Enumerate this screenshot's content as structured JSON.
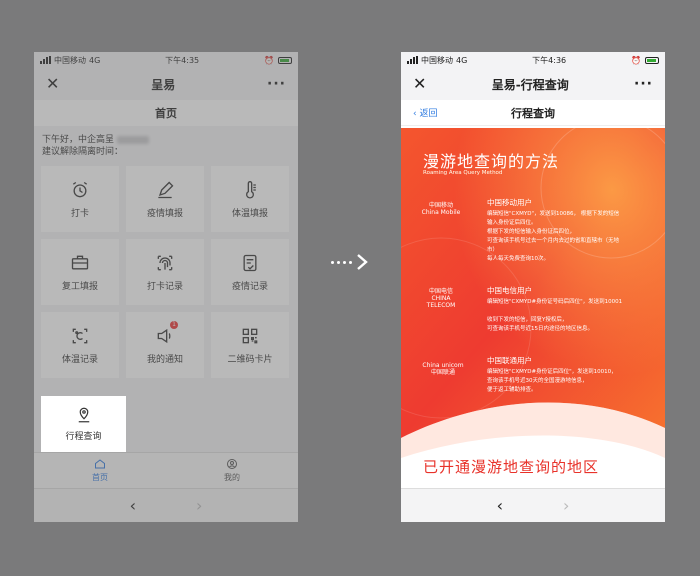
{
  "left_phone": {
    "status": {
      "carrier": "中国移动",
      "network": "4G",
      "time": "下午4:35"
    },
    "window_title": "呈易",
    "page_header": "首页",
    "greeting_line1": "下午好，中企高呈",
    "greeting_line2": "建议解除隔离时间：",
    "tiles": [
      "打卡",
      "疫情填报",
      "体温填报",
      "复工填报",
      "打卡记录",
      "疫情记录",
      "体温记录",
      "我的通知",
      "二维码卡片",
      "行程查询"
    ],
    "badge": "1",
    "tabs": [
      "首页",
      "我的"
    ]
  },
  "right_phone": {
    "status": {
      "carrier": "中国移动",
      "network": "4G",
      "time": "下午4:36"
    },
    "window_title": "呈易-行程查询",
    "back_label": "返回",
    "page_header": "行程查询",
    "hero_title": "漫游地查询的方法",
    "hero_subtitle": "Roaming Area Query Method",
    "operators": [
      {
        "logo": "中国移动 China Mobile",
        "name": "中国移动用户",
        "lines": [
          "编辑短信\"CXMYD\"，发送到10086，  根据下发的短信",
          "输入身份证后四位。",
          "根据下发的短信输入身份证后四位，",
          "可查询该手机号过去一个月内去过的省和直辖市（无地",
          "市）",
          "每人每天免费查询10次。"
        ]
      },
      {
        "logo": "中国电信 CHINA TELECOM",
        "name": "中国电信用户",
        "lines": [
          "编辑短信\"CXMYD#身份证号码后四位\"，发送到10001",
          "",
          "收到下发的短信，回复Y授权后，",
          "可查询该手机号近15日内途径的地区信息。"
        ]
      },
      {
        "logo": "China unicom 中国联通",
        "name": "中国联通用户",
        "lines": [
          "编辑短信\"CXMYD#身份证后四位\"，发送到10010，",
          "查询该手机号近30天的全国漫游地信息，",
          "便于返工辅助排查。"
        ]
      }
    ],
    "bottom_title": "已开通漫游地查询的地区"
  },
  "colors": {
    "accent": "#2f7be0",
    "hero_red": "#e8322a",
    "hero_orange": "#f7722f"
  },
  "icons": [
    "alarm-clock-icon",
    "pencil-icon",
    "thermometer-icon",
    "briefcase-icon",
    "fingerprint-icon",
    "document-check-icon",
    "temperature-c-icon",
    "speaker-icon",
    "qr-code-icon",
    "location-pin-icon",
    "home-icon",
    "user-icon"
  ]
}
